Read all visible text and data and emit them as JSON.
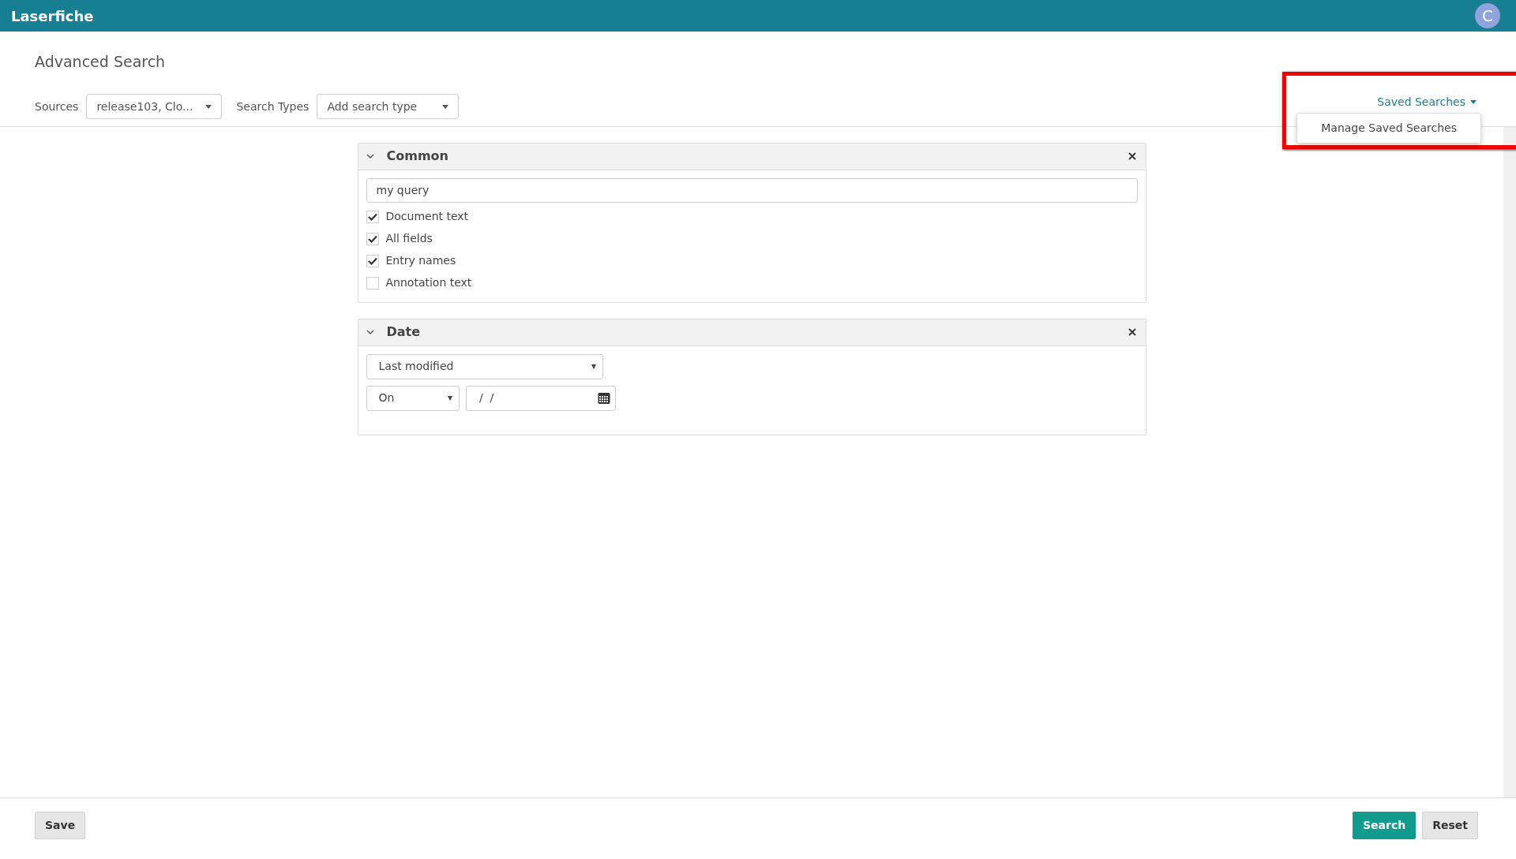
{
  "header": {
    "logo": "Laserfiche",
    "avatar": "C"
  },
  "title": "Advanced Search",
  "toolbar": {
    "sources_label": "Sources",
    "sources_value": "release103, Clo...",
    "types_label": "Search Types",
    "types_value": "Add search type",
    "saved_searches": "Saved Searches",
    "menu": [
      {
        "label": "Manage Saved Searches"
      }
    ],
    "highlight": true
  },
  "panels": [
    {
      "kind": "common",
      "title": "Common",
      "expanded": true,
      "query": "my query",
      "options": [
        {
          "label": "Document text",
          "checked": true
        },
        {
          "label": "All fields",
          "checked": true
        },
        {
          "label": "Entry names",
          "checked": true
        },
        {
          "label": "Annotation text",
          "checked": false
        }
      ]
    },
    {
      "kind": "date",
      "title": "Date",
      "expanded": true,
      "field": "Last modified",
      "operator": "On",
      "date": " /  /"
    }
  ],
  "footer": {
    "left": [
      "Save"
    ],
    "right": [
      {
        "label": "Search",
        "primary": true
      },
      {
        "label": "Reset",
        "primary": false
      }
    ]
  }
}
